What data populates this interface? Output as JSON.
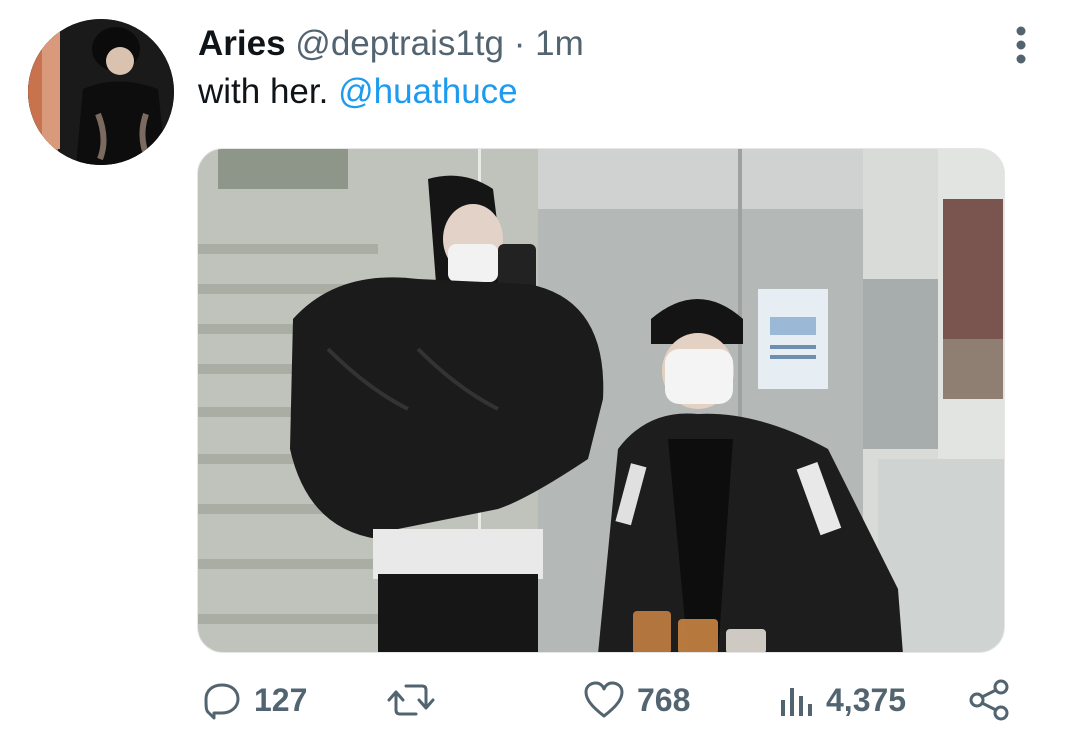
{
  "tweet": {
    "display_name": "Aries",
    "handle": "@deptrais1tg",
    "separator": "·",
    "timestamp": "1m",
    "text": "with her.",
    "mention": "@huathuce"
  },
  "actions": {
    "reply": {
      "icon": "reply-icon",
      "count": "127"
    },
    "retweet": {
      "icon": "retweet-icon",
      "count": ""
    },
    "like": {
      "icon": "heart-icon",
      "count": "768"
    },
    "views": {
      "icon": "analytics-icon",
      "count": "4,375"
    },
    "share": {
      "icon": "share-icon"
    }
  },
  "menu": {
    "icon": "more-vertical-icon"
  },
  "colors": {
    "text_primary": "#0f1419",
    "text_secondary": "#536471",
    "link": "#1d9bf0",
    "background": "#ffffff"
  }
}
